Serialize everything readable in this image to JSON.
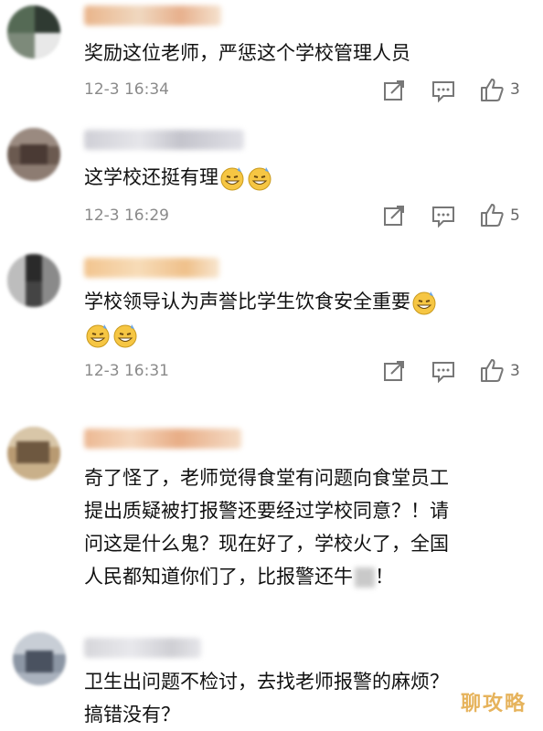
{
  "comments": [
    {
      "text": "奖励这位老师，严惩这个学校管理人员",
      "time": "12-3 16:34",
      "likes": "3"
    },
    {
      "text": "这学校还挺有理",
      "time": "12-3 16:29",
      "likes": "5"
    },
    {
      "text": "学校领导认为声誉比学生饮食安全重要",
      "time": "12-3 16:31",
      "likes": "3"
    },
    {
      "lines": [
        "奇了怪了，老师觉得食堂有问题向食堂员工",
        "提出质疑被打报警还要经过学校同意？！请",
        "问这是什么鬼？现在好了，学校火了，全国",
        "人民都知道你们了，比报警还牛"
      ],
      "trailing": "！"
    },
    {
      "lines": [
        "卫生出问题不检讨，去找老师报警的麻烦？",
        "搞错没有？"
      ]
    }
  ],
  "icons": {
    "share": "share-icon",
    "comment": "comment-icon",
    "like": "thumbs-up-icon",
    "emoji": "grin-sweat-emoji-icon"
  },
  "watermark": "聊攻略",
  "colors": {
    "text": "#111111",
    "time": "#8a8a8a",
    "watermark": "#e2a640"
  }
}
